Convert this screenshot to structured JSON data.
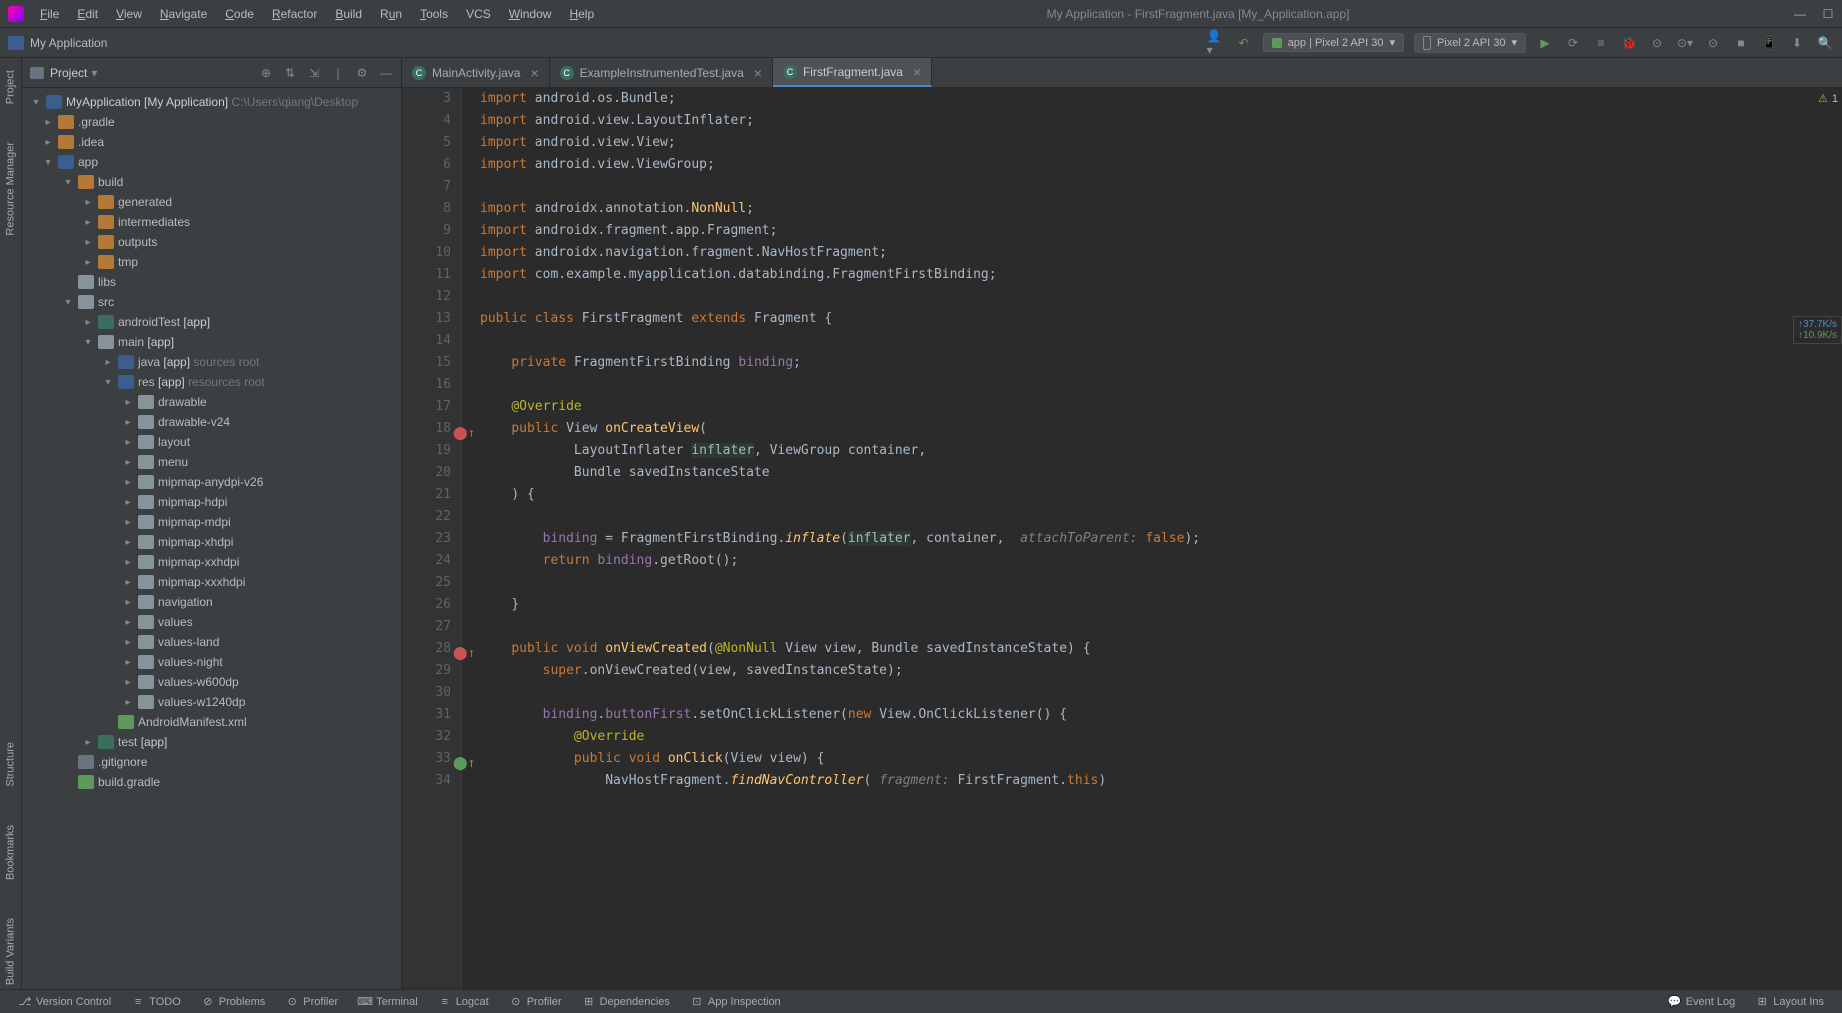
{
  "window": {
    "title": "My Application - FirstFragment.java [My_Application.app]"
  },
  "menubar": {
    "file": "File",
    "edit": "Edit",
    "view": "View",
    "navigate": "Navigate",
    "code": "Code",
    "refactor": "Refactor",
    "build": "Build",
    "run": "Run",
    "tools": "Tools",
    "vcs": "VCS",
    "window": "Window",
    "help": "Help"
  },
  "toolbar": {
    "breadcrumb": "My Application",
    "run_config": "app | Pixel 2 API 30",
    "device": "Pixel 2 API 30"
  },
  "left_rail": {
    "project": "Project",
    "resource_manager": "Resource Manager",
    "structure": "Structure",
    "bookmarks": "Bookmarks",
    "build_variants": "Build Variants"
  },
  "project_panel": {
    "title": "Project",
    "root": {
      "name": "MyApplication",
      "badge": "[My Application]",
      "path": "C:\\Users\\qiang\\Desktop"
    },
    "items": {
      "gradle": ".gradle",
      "idea": ".idea",
      "app": "app",
      "build": "build",
      "generated": "generated",
      "intermediates": "intermediates",
      "outputs": "outputs",
      "tmp": "tmp",
      "libs": "libs",
      "src": "src",
      "androidTest": "androidTest",
      "androidTest_badge": "[app]",
      "main": "main",
      "main_badge": "[app]",
      "java": "java",
      "java_badge": "[app]",
      "java_hint": "sources root",
      "res": "res",
      "res_badge": "[app]",
      "res_hint": "resources root",
      "drawable": "drawable",
      "drawable_v24": "drawable-v24",
      "layout": "layout",
      "menu": "menu",
      "mipmap_anydpi_v26": "mipmap-anydpi-v26",
      "mipmap_hdpi": "mipmap-hdpi",
      "mipmap_mdpi": "mipmap-mdpi",
      "mipmap_xhdpi": "mipmap-xhdpi",
      "mipmap_xxhdpi": "mipmap-xxhdpi",
      "mipmap_xxxhdpi": "mipmap-xxxhdpi",
      "navigation": "navigation",
      "values": "values",
      "values_land": "values-land",
      "values_night": "values-night",
      "values_w600dp": "values-w600dp",
      "values_w1240dp": "values-w1240dp",
      "manifest": "AndroidManifest.xml",
      "test": "test",
      "test_badge": "[app]",
      "gitignore": ".gitignore",
      "build_gradle": "build.gradle"
    }
  },
  "editor": {
    "tabs": {
      "tab1": "MainActivity.java",
      "tab2": "ExampleInstrumentedTest.java",
      "tab3": "FirstFragment.java"
    },
    "warn_count": "1",
    "net_up": "↑37.7K/s",
    "net_down": "↑10.9K/s",
    "lines": {
      "l3": "3",
      "l4": "4",
      "l5": "5",
      "l6": "6",
      "l7": "7",
      "l8": "8",
      "l9": "9",
      "l10": "10",
      "l11": "11",
      "l12": "12",
      "l13": "13",
      "l14": "14",
      "l15": "15",
      "l16": "16",
      "l17": "17",
      "l18": "18",
      "l19": "19",
      "l20": "20",
      "l21": "21",
      "l22": "22",
      "l23": "23",
      "l24": "24",
      "l25": "25",
      "l26": "26",
      "l27": "27",
      "l28": "28",
      "l29": "29",
      "l30": "30",
      "l31": "31",
      "l32": "32",
      "l33": "33",
      "l34": "34"
    },
    "code": {
      "import": "import ",
      "c3": "android.os.Bundle;",
      "c4": "android.view.LayoutInflater;",
      "c5": "android.view.View;",
      "c6": "android.view.ViewGroup;",
      "c8": "androidx.annotation.NonNull;",
      "c9": "androidx.fragment.app.Fragment;",
      "c10": "androidx.navigation.fragment.NavHostFragment;",
      "c11": "com.example.myapplication.databinding.FragmentFirstBinding;",
      "public": "public ",
      "class": "class ",
      "c13_name": "FirstFragment ",
      "extends": "extends ",
      "c13_sup": "Fragment {",
      "private": "private ",
      "c15_type": "FragmentFirstBinding ",
      "c15_field": "binding",
      "semicolon": ";",
      "override": "@Override",
      "c18_ret": "View ",
      "c18_fn": "onCreateView",
      "c18_open": "(",
      "c19_t1": "LayoutInflater ",
      "c19_p1": "inflater",
      "c19_comma": ", ViewGroup ",
      "c19_p2": "container",
      "c19_end": ",",
      "c20_t": "Bundle ",
      "c20_p": "savedInstanceState",
      "c21": ") {",
      "c23_lhs": "binding = FragmentFirstBinding.",
      "c23_inf": "inflate",
      "c23_args": "(inflater, container,  ",
      "c23_hint": "attachToParent: ",
      "false": "false",
      "c23_end": ");",
      "return": "return ",
      "c24_rhs": "binding.getRoot();",
      "c26": "}",
      "void": "void ",
      "c28_fn": "onViewCreated",
      "c28_args": "(@NonNull View view, Bundle savedInstanceState) {",
      "c28_ann": "@NonNull",
      "c28_rest1": " View view, Bundle savedInstanceState) {",
      "super": "super",
      "c29_rest": ".onViewCreated(view, savedInstanceState);",
      "c31_lhs": "binding.",
      "c31_field": "buttonFirst",
      "c31_rest": ".setOnClickListener(",
      "new": "new ",
      "c31_cls": "View.OnClickListener() {",
      "c33_fn": "onClick",
      "c33_args": "(View view) {",
      "c34_cls": "NavHostFragment.",
      "c34_fn": "findNavController",
      "c34_open": "( ",
      "c34_hint": "fragment: ",
      "c34_arg": "FirstFragment.",
      "this": "this",
      "c34_end": ")"
    }
  },
  "statusbar": {
    "version_control": "Version Control",
    "todo": "TODO",
    "problems": "Problems",
    "profiler": "Profiler",
    "terminal": "Terminal",
    "logcat": "Logcat",
    "profiler2": "Profiler",
    "dependencies": "Dependencies",
    "app_inspection": "App Inspection",
    "event_log": "Event Log",
    "layout_ins": "Layout Ins"
  }
}
